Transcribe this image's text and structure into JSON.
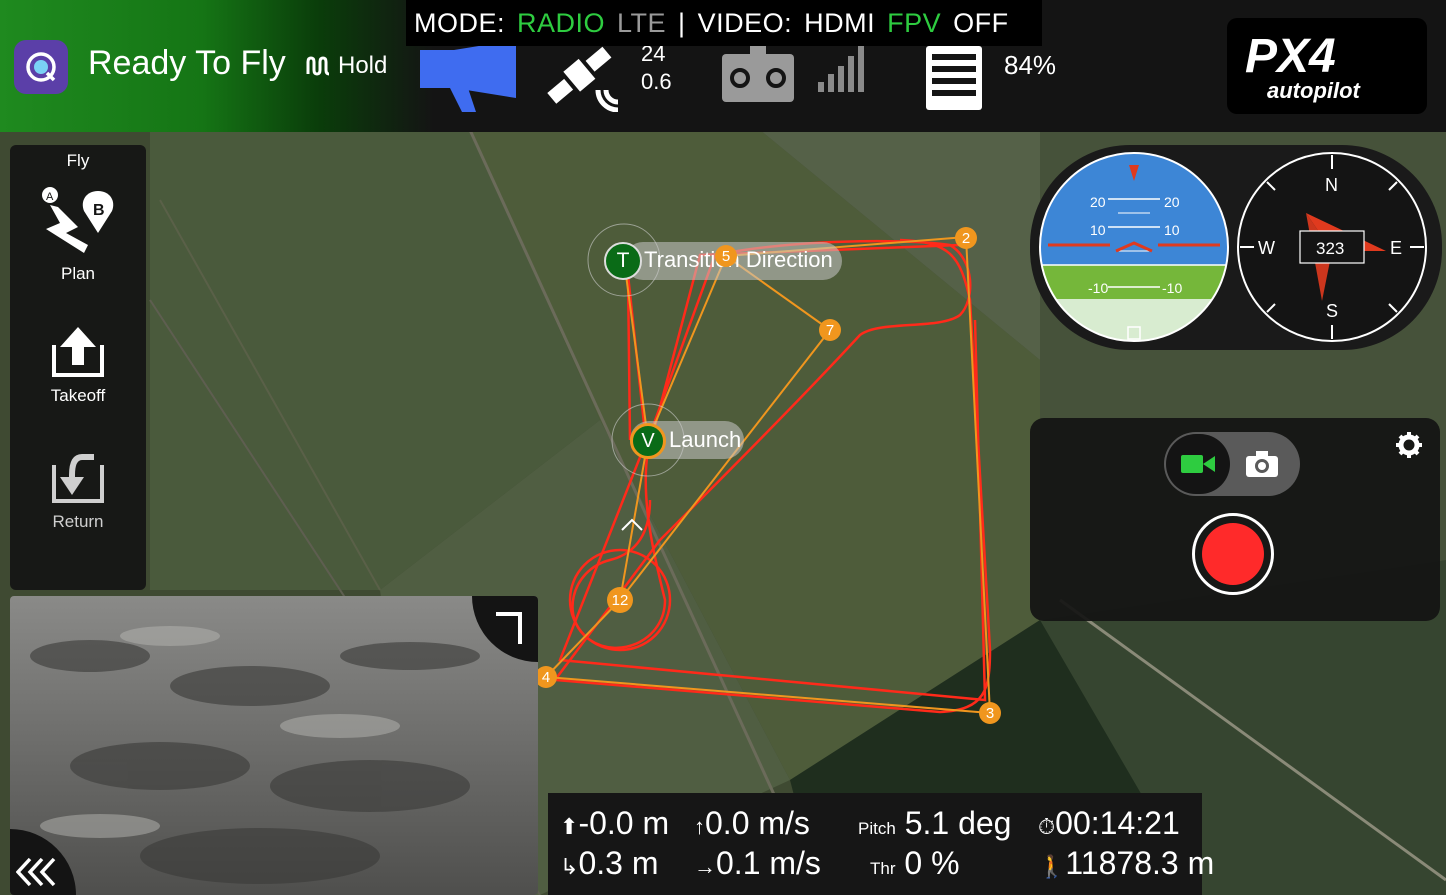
{
  "status": {
    "ready": "Ready To Fly",
    "flight_mode": "Hold"
  },
  "mode_banner": {
    "mode_label": "MODE:",
    "radio": "RADIO",
    "lte": "LTE",
    "separator": "|",
    "video_label": "VIDEO:",
    "hdmi": "HDMI",
    "fpv": "FPV",
    "off": "OFF"
  },
  "gps": {
    "satellites": "24",
    "hdop": "0.6"
  },
  "battery": {
    "percent": "84%"
  },
  "logo": {
    "text": "PX4",
    "subtext": "autopilot"
  },
  "toolbar": {
    "header": "Fly",
    "plan": "Plan",
    "takeoff": "Takeoff",
    "return": "Return"
  },
  "map": {
    "transition_marker": "T",
    "transition_label": "Transition Direction",
    "vehicle_marker": "V",
    "launch_label": "Launch",
    "waypoints": [
      "2",
      "3",
      "4",
      "5",
      "7",
      "12"
    ]
  },
  "compass": {
    "heading": "323",
    "n": "N",
    "s": "S",
    "e": "E",
    "w": "W"
  },
  "attitude": {
    "pitch_marks": [
      "20",
      "20",
      "10",
      "10",
      "-10",
      "-10"
    ]
  },
  "telemetry": {
    "altitude": "-0.0 m",
    "vertical_speed": "0.0 m/s",
    "pitch_label": "Pitch",
    "pitch_value": "5.1 deg",
    "flight_time": "00:14:21",
    "distance": "0.3 m",
    "ground_speed": "0.1 m/s",
    "throttle_label": "Thr",
    "throttle_value": "0 %",
    "total_distance": "11878.3 m"
  },
  "colors": {
    "accent_green": "#2ecc40",
    "path_red": "#ff2a1a",
    "waypoint_orange": "#f0961e",
    "record_red": "#ff2a2a"
  }
}
